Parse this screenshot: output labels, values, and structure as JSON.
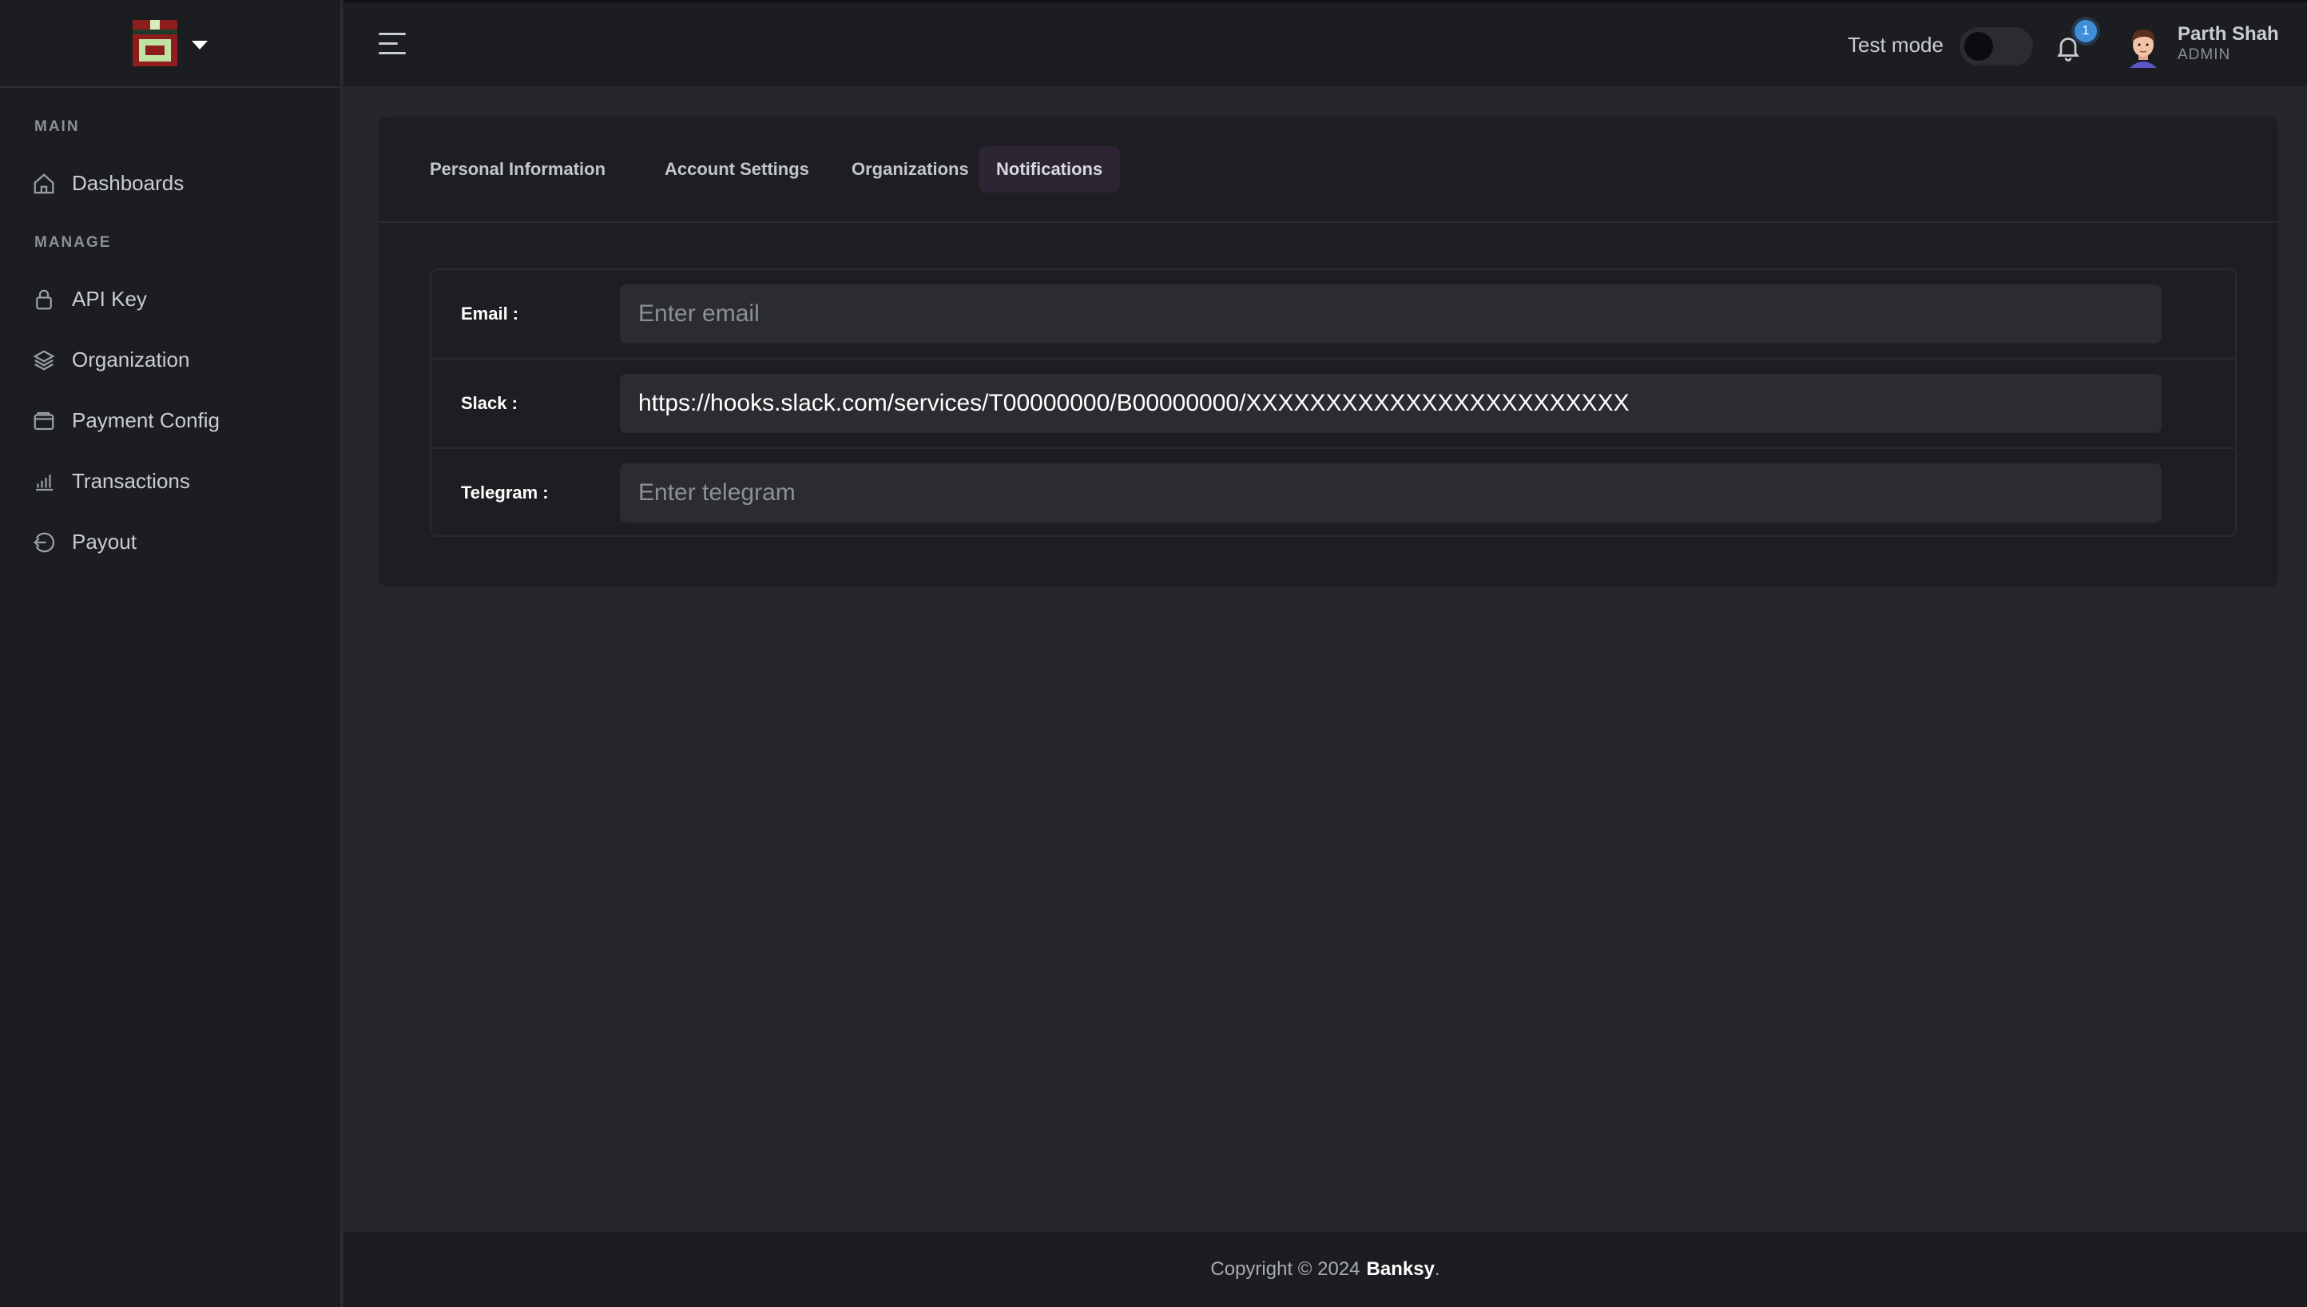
{
  "sidebar": {
    "sections": [
      {
        "title": "MAIN"
      },
      {
        "title": "MANAGE"
      }
    ],
    "items": [
      {
        "label": "Dashboards",
        "icon": "home-icon"
      },
      {
        "label": "API Key",
        "icon": "lock-icon"
      },
      {
        "label": "Organization",
        "icon": "layers-icon"
      },
      {
        "label": "Payment Config",
        "icon": "wallet-icon"
      },
      {
        "label": "Transactions",
        "icon": "bar-chart-icon"
      },
      {
        "label": "Payout",
        "icon": "logout-icon"
      }
    ]
  },
  "topbar": {
    "test_mode_label": "Test mode",
    "test_mode_enabled": false,
    "notification_count": "1",
    "user": {
      "name": "Parth Shah",
      "role": "ADMIN"
    }
  },
  "tabs": [
    {
      "label": "Personal Information",
      "active": false
    },
    {
      "label": "Account Settings",
      "active": false
    },
    {
      "label": "Organizations",
      "active": false
    },
    {
      "label": "Notifications",
      "active": true
    }
  ],
  "form": {
    "email": {
      "label": "Email :",
      "value": "",
      "placeholder": "Enter email"
    },
    "slack": {
      "label": "Slack :",
      "value": "https://hooks.slack.com/services/T00000000/B00000000/XXXXXXXXXXXXXXXXXXXXXXXX",
      "placeholder": ""
    },
    "telegram": {
      "label": "Telegram :",
      "value": "",
      "placeholder": "Enter telegram"
    }
  },
  "footer": {
    "prefix": "Copyright © 2024",
    "brand": "Banksy",
    "suffix": "."
  },
  "colors": {
    "accent_tab_bg": "#2e2534",
    "badge": "#3f8fd8",
    "sidebar_bg": "#1c1d20",
    "content_bg": "#26272a"
  }
}
